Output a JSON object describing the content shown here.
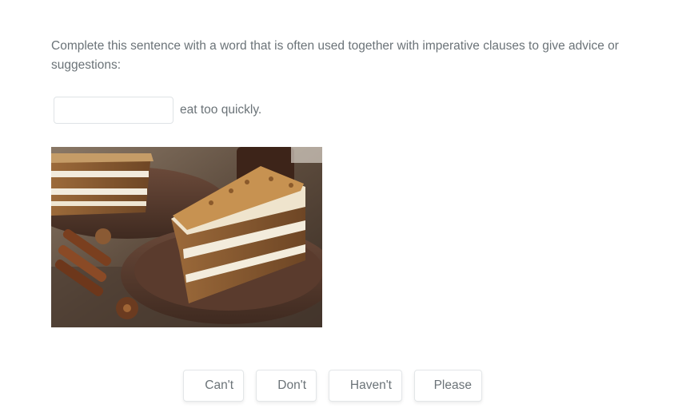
{
  "question": {
    "prompt": "Complete this sentence with a word that is often used together with imperative clauses to give advice or suggestions:",
    "input_value": "",
    "sentence_rest": "eat too quickly."
  },
  "image": {
    "subject": "carrot-cake-slice"
  },
  "options": [
    {
      "label": "Can't"
    },
    {
      "label": "Don't"
    },
    {
      "label": "Haven't"
    },
    {
      "label": "Please"
    }
  ]
}
